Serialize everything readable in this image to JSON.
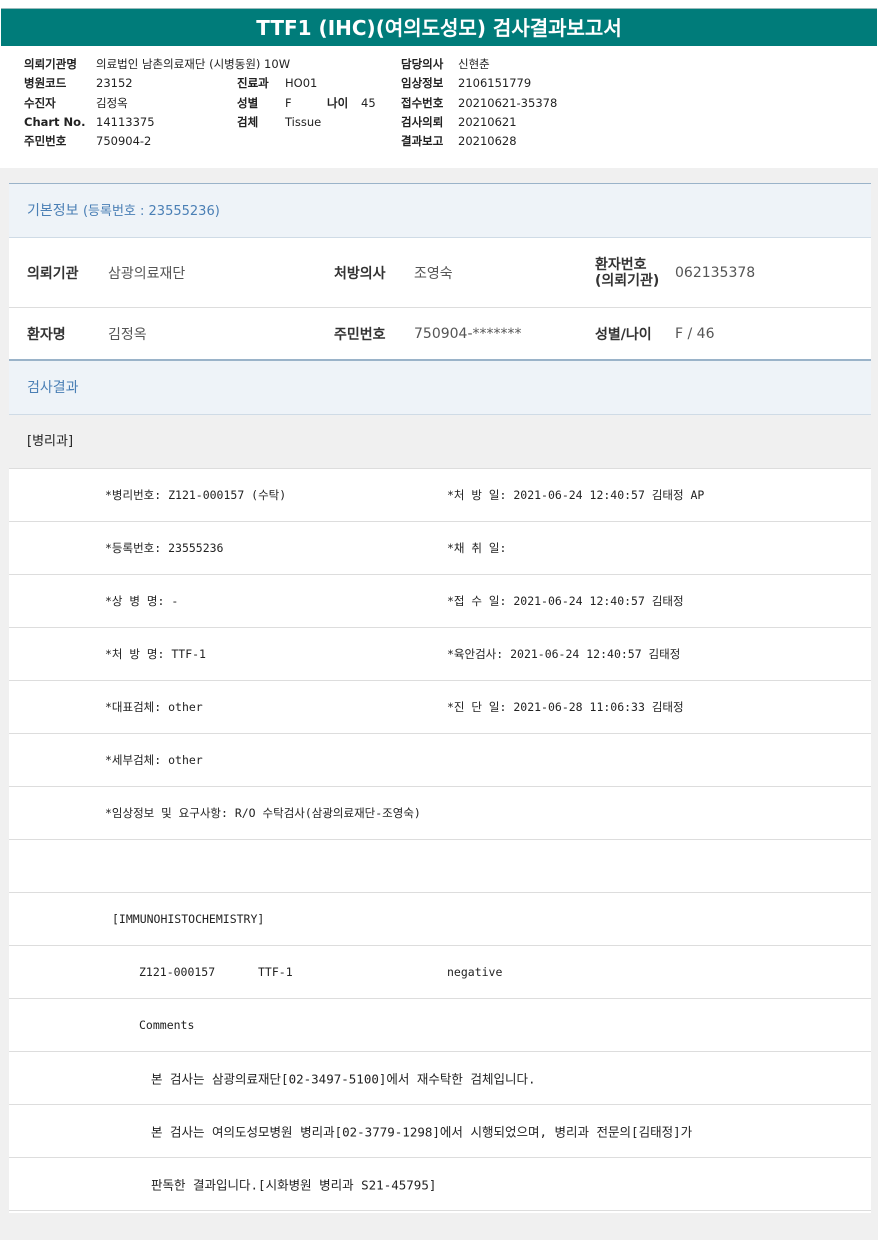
{
  "title": "TTF1 (IHC)(여의도성모) 검사결과보고서",
  "header": {
    "institution_label": "의뢰기관명",
    "institution": "의료법인 남촌의료재단 (시병동원) 10W",
    "hospital_code_label": "병원코드",
    "hospital_code": "23152",
    "dept_label": "진료과",
    "dept": "HO01",
    "patient_label": "수진자",
    "patient": "김정옥",
    "sex_label": "성별",
    "sex": "F",
    "age_label": "나이",
    "age": "45",
    "chart_label": "Chart No.",
    "chart": "14113375",
    "specimen_label": "검체",
    "specimen": "Tissue",
    "resident_label": "주민번호",
    "resident": "750904-2",
    "doctor_label": "담당의사",
    "doctor": "신현춘",
    "clinical_label": "임상정보",
    "clinical": "2106151779",
    "receipt_label": "접수번호",
    "receipt": "20210621-35378",
    "request_label": "검사의뢰",
    "request": "20210621",
    "report_label": "결과보고",
    "report": "20210628"
  },
  "basic": {
    "title": "기본정보",
    "reg": "(등록번호 : 23555236)",
    "inst_label": "의뢰기관",
    "inst": "삼광의료재단",
    "presc_label": "처방의사",
    "presc": "조영숙",
    "pno_label1": "환자번호",
    "pno_label2": "(의뢰기관)",
    "pno": "062135378",
    "name_label": "환자명",
    "name": "김정옥",
    "rrn_label": "주민번호",
    "rrn": "750904-*******",
    "sexage_label": "성별/나이",
    "sexage": "F / 46"
  },
  "results": {
    "title": "검사결과",
    "dept": "[병리과]",
    "rows": [
      {
        "left": "*병리번호: Z121-000157 (수탁)",
        "right": "*처 방 일: 2021-06-24 12:40:57  김태정 AP"
      },
      {
        "left": "*등록번호: 23555236",
        "right": "*채 취 일:"
      },
      {
        "left": "*상 병 명: -",
        "right": "*접 수 일: 2021-06-24 12:40:57  김태정"
      },
      {
        "left": "*처 방 명: TTF-1",
        "right": "*육안검사: 2021-06-24 12:40:57  김태정"
      },
      {
        "left": "*대표검체: other",
        "right": "*진 단 일: 2021-06-28 11:06:33  김태정"
      },
      {
        "left": "*세부검체: other",
        "right": ""
      }
    ],
    "clinical_note": "*임상정보 및 요구사항: R/O 수탁검사(삼광의료재단-조영숙)",
    "ihc_header": "[IMMUNOHISTOCHEMISTRY]",
    "ihc_id": "Z121-000157",
    "ihc_test": "TTF-1",
    "ihc_result": "negative",
    "comments_label": "Comments",
    "comments": [
      "본 검사는 삼광의료재단[02-3497-5100]에서 재수탁한 검체입니다.",
      "본 검사는 여의도성모병원 병리과[02-3779-1298]에서 시행되었으며, 병리과 전문의[김태정]가",
      "판독한 결과입니다.[시화병원 병리과 S21-45795]"
    ]
  }
}
